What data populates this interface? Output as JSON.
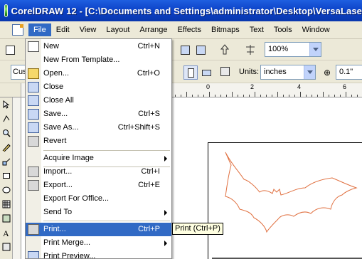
{
  "window": {
    "title": "CorelDRAW 12 - [C:\\Documents and Settings\\administrator\\Desktop\\VersaLase"
  },
  "menubar": {
    "items": [
      "File",
      "Edit",
      "View",
      "Layout",
      "Arrange",
      "Effects",
      "Bitmaps",
      "Text",
      "Tools",
      "Window"
    ],
    "active": "File"
  },
  "toolbar": {
    "zoom_value": "100%",
    "font_partial": "Cus",
    "units_label": "Units:",
    "units_value": "inches",
    "nudge_value": "0.1\""
  },
  "ruler": {
    "labels": [
      "0",
      "2",
      "4",
      "6"
    ]
  },
  "file_menu": {
    "items": [
      {
        "label": "New",
        "shortcut": "Ctrl+N",
        "icon": "new-document-icon"
      },
      {
        "label": "New From Template...",
        "shortcut": "",
        "icon": "none"
      },
      {
        "label": "Open...",
        "shortcut": "Ctrl+O",
        "icon": "open-folder-icon"
      },
      {
        "label": "Close",
        "shortcut": "",
        "icon": "close-document-icon"
      },
      {
        "label": "Close All",
        "shortcut": "",
        "icon": "close-all-icon"
      },
      {
        "label": "Save...",
        "shortcut": "Ctrl+S",
        "icon": "save-icon"
      },
      {
        "label": "Save As...",
        "shortcut": "Ctrl+Shift+S",
        "icon": "save-as-icon"
      },
      {
        "label": "Revert",
        "shortcut": "",
        "icon": "revert-icon"
      },
      {
        "label": "Acquire Image",
        "shortcut": "",
        "icon": "none",
        "submenu": true
      },
      {
        "label": "Import...",
        "shortcut": "Ctrl+I",
        "icon": "import-icon"
      },
      {
        "label": "Export...",
        "shortcut": "Ctrl+E",
        "icon": "export-icon"
      },
      {
        "label": "Export For Office...",
        "shortcut": "",
        "icon": "none"
      },
      {
        "label": "Send To",
        "shortcut": "",
        "icon": "none",
        "submenu": true
      },
      {
        "label": "Print...",
        "shortcut": "Ctrl+P",
        "icon": "print-icon",
        "highlighted": true
      },
      {
        "label": "Print Merge...",
        "shortcut": "",
        "icon": "none",
        "submenu": true
      },
      {
        "label": "Print Preview...",
        "shortcut": "",
        "icon": "print-preview-icon"
      }
    ]
  },
  "tooltip": {
    "text": "Print (Ctrl+P)"
  },
  "colors": {
    "title_bar": "#0a3fc4",
    "menu_highlight": "#316ac5",
    "chrome": "#ece9d8",
    "bat_outline": "#e07040"
  }
}
